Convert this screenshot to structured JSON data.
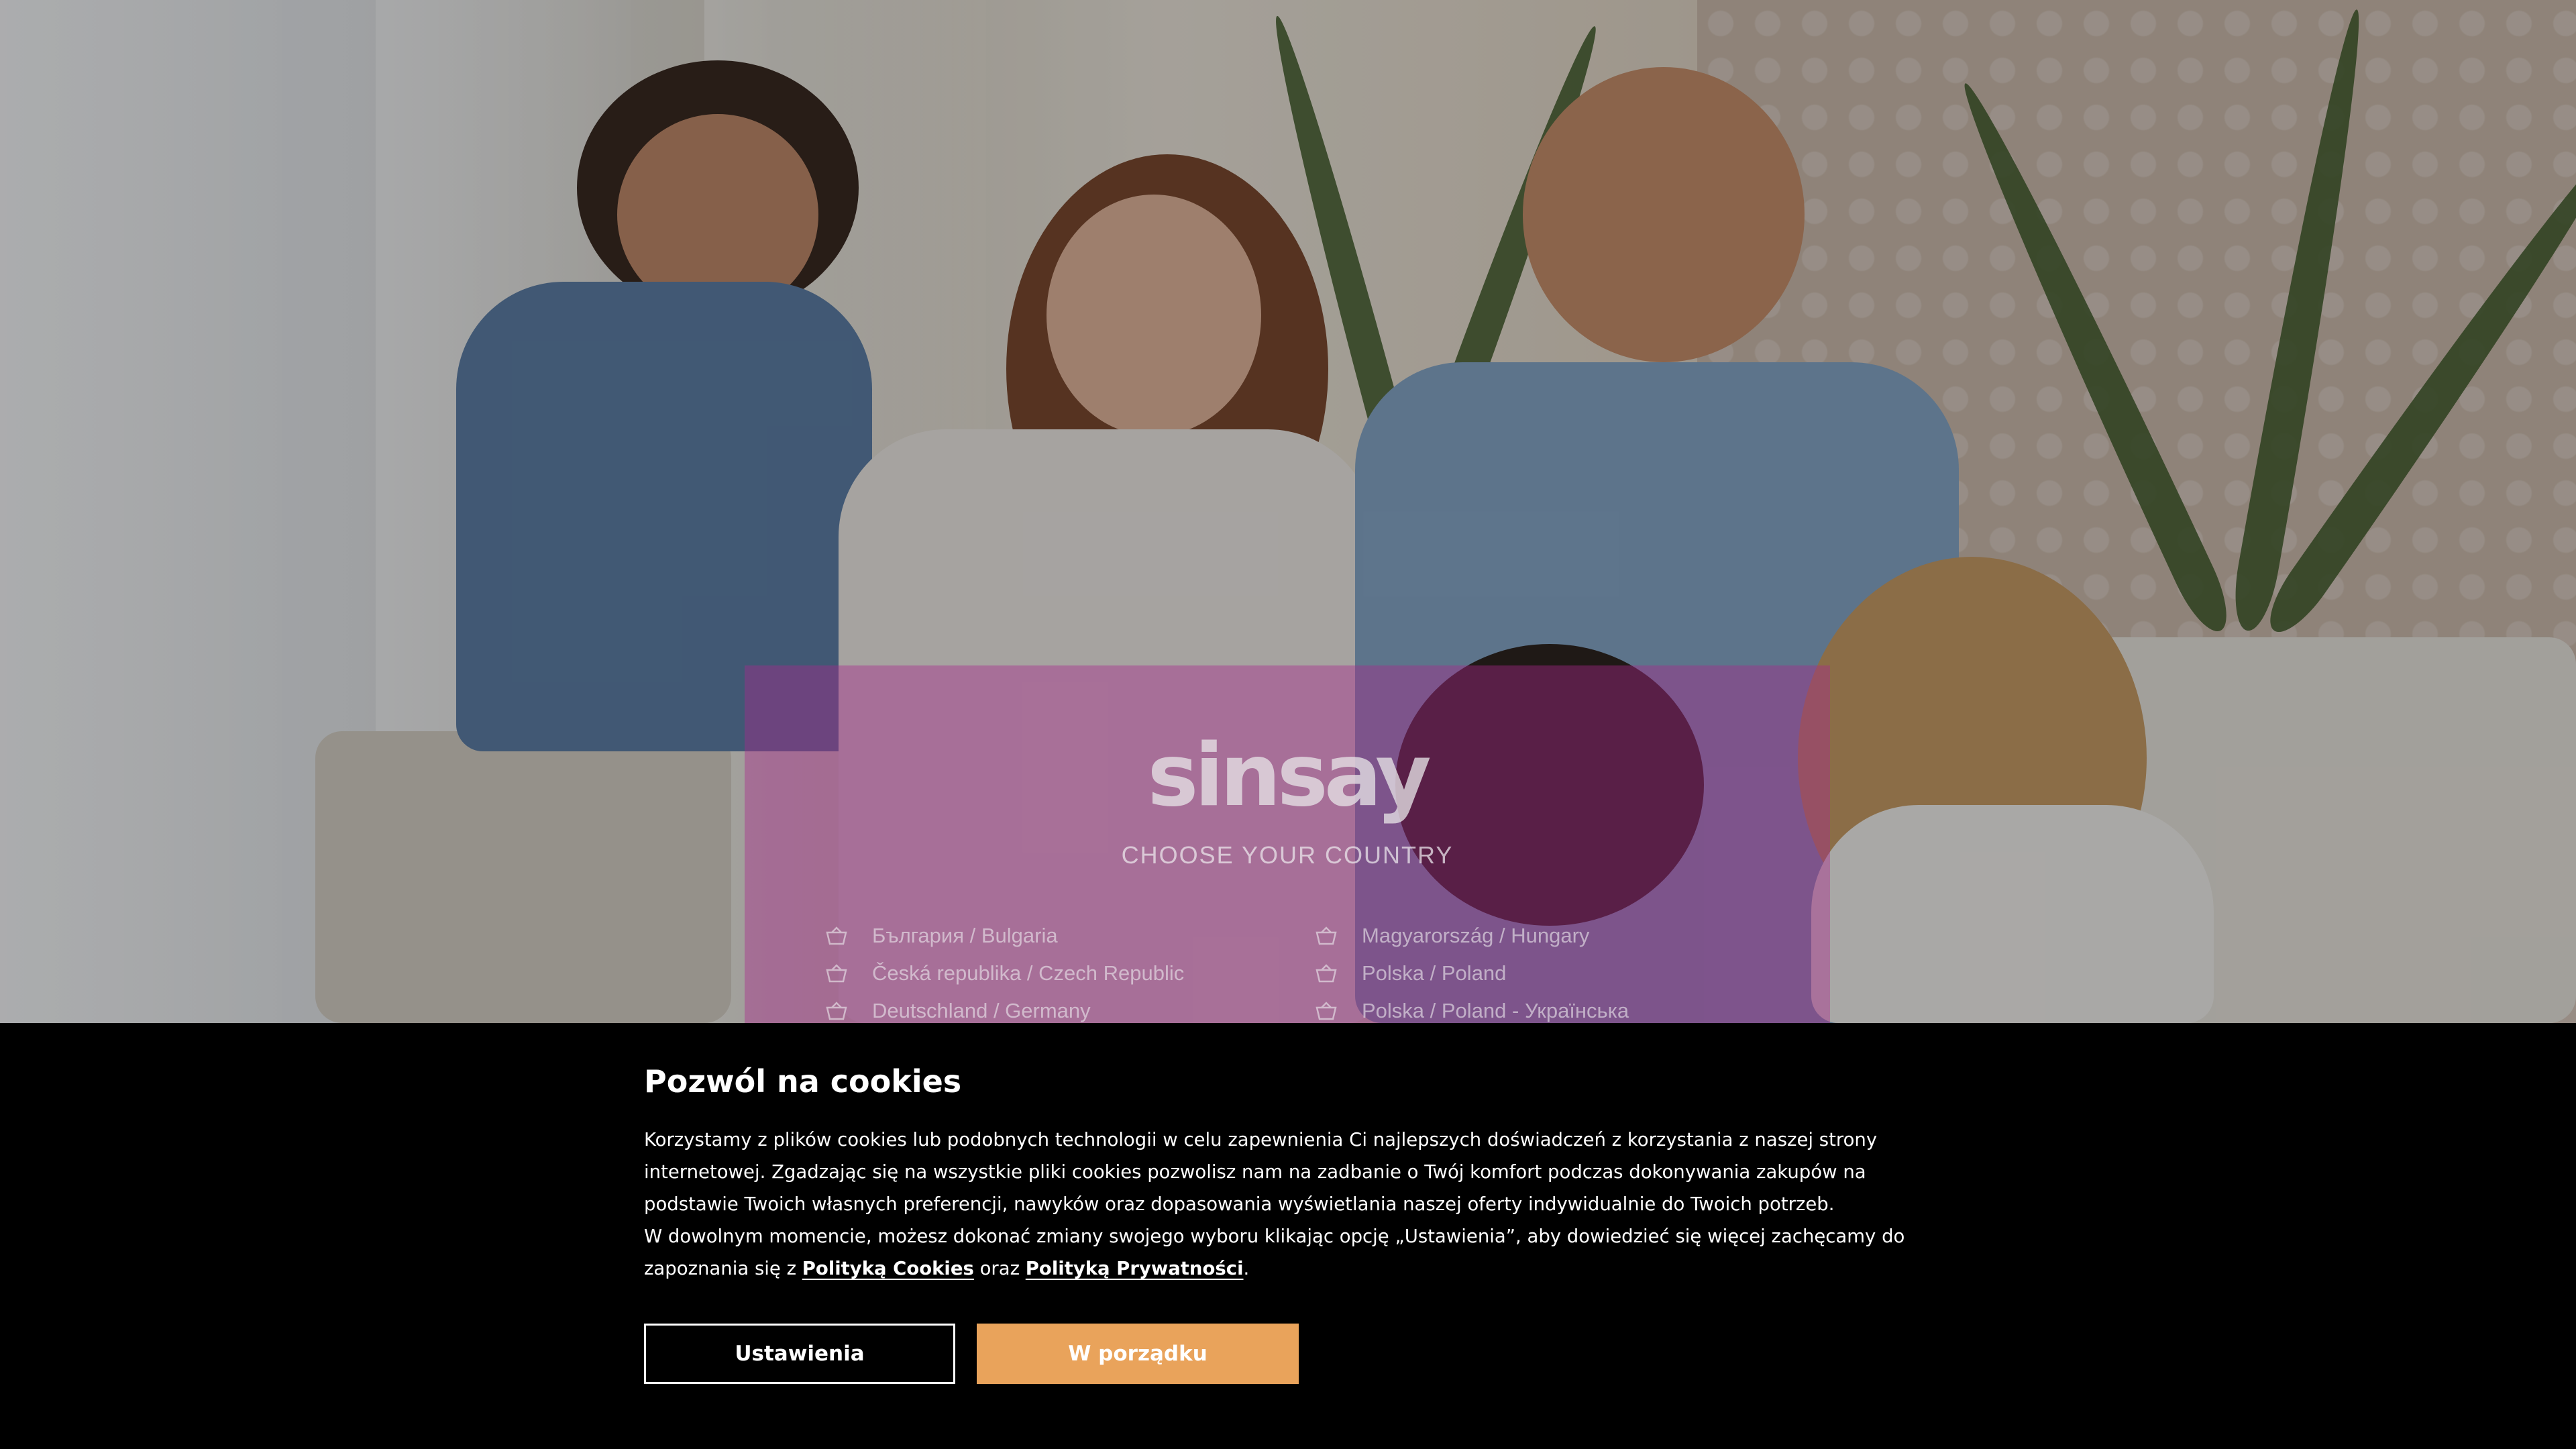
{
  "brand": {
    "logo_text": "sinsay"
  },
  "chooser": {
    "title": "CHOOSE YOUR COUNTRY",
    "countries_left": [
      "България / Bulgaria",
      "Česká republika / Czech Republic",
      "Deutschland / Germany"
    ],
    "countries_right": [
      "Magyarország / Hungary",
      "Polska / Poland",
      "Polska / Poland - Українська"
    ],
    "item_icon": "basket-icon"
  },
  "cookie": {
    "title": "Pozwól na cookies",
    "text_part1": "Korzystamy z plików cookies lub podobnych technologii w celu zapewnienia Ci najlepszych doświadczeń z korzystania z naszej strony internetowej. Zgadzając się na wszystkie pliki cookies pozwolisz nam na zadbanie o Twój komfort podczas dokonywania zakupów na podstawie Twoich własnych preferencji, nawyków oraz dopasowania wyświetlania naszej oferty indywidualnie do Twoich potrzeb.",
    "text_part2": "W dowolnym momencie, możesz dokonać zmiany swojego wyboru klikając opcję „Ustawienia”, aby dowiedzieć się więcej zachęcamy do zapoznania się z",
    "link_cookies": "Polityką Cookies",
    "conjunction": "oraz",
    "link_privacy": "Polityką Prywatności",
    "period": ".",
    "settings_label": "Ustawienia",
    "accept_label": "W porządku",
    "accept_color": "#e9a35b"
  }
}
